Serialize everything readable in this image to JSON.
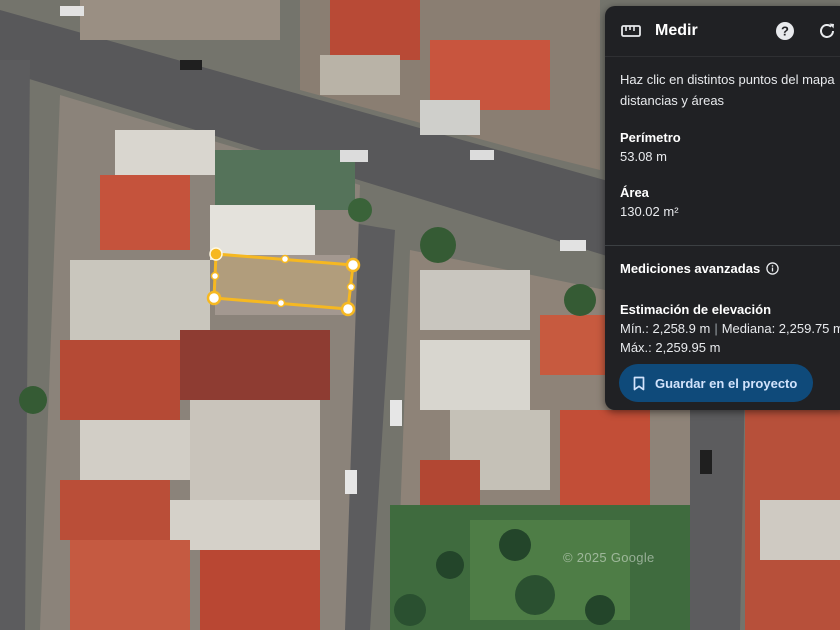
{
  "panel": {
    "title": "Medir",
    "instructions": "Haz clic en distintos puntos del mapa distancias y áreas",
    "perimeter": {
      "label": "Perímetro",
      "value": "53.08 m"
    },
    "area": {
      "label": "Área",
      "value": "130.02 m²"
    },
    "advanced": {
      "label": "Mediciones avanzadas"
    },
    "elevation": {
      "label": "Estimación de elevación",
      "min": "Mín.: 2,258.9 m",
      "median": "Mediana: 2,259.75 m",
      "max": "Máx.: 2,259.95 m"
    },
    "save_label": "Guardar en el proyecto",
    "icons": [
      "ruler-icon",
      "help-icon",
      "refresh-icon",
      "info-icon",
      "bookmark-icon"
    ]
  },
  "map": {
    "watermark": "© 2025 Google",
    "measure_color": "#f6b821"
  }
}
